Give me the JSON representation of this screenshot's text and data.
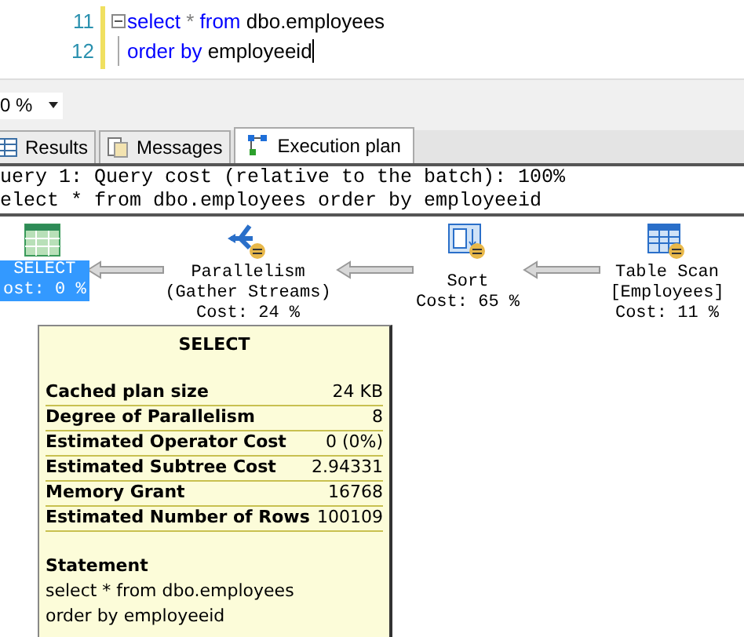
{
  "editor": {
    "lines": [
      {
        "number": "11",
        "fold": true,
        "segments": [
          {
            "text": "select",
            "kind": "keyword"
          },
          {
            "text": " * ",
            "kind": "operator"
          },
          {
            "text": "from",
            "kind": "keyword"
          },
          {
            "text": " dbo.employees",
            "kind": "plain"
          }
        ]
      },
      {
        "number": "12",
        "fold": false,
        "segments": [
          {
            "text": "order by",
            "kind": "keyword"
          },
          {
            "text": " employeeid",
            "kind": "plain"
          }
        ]
      }
    ]
  },
  "zoom": {
    "value": "0 %"
  },
  "tabs": [
    {
      "label": "Results",
      "kind": "grid",
      "selected": false
    },
    {
      "label": "Messages",
      "kind": "doc",
      "selected": false
    },
    {
      "label": "Execution plan",
      "kind": "plan",
      "selected": true
    }
  ],
  "query_header": [
    "uery 1: Query cost (relative to the batch): 100%",
    "elect * from dbo.employees order by employeeid"
  ],
  "plan_nodes": [
    {
      "kind": "select",
      "lines": [
        "SELECT"
      ],
      "cost": "ost: 0 %",
      "selected": true
    },
    {
      "kind": "parallelism",
      "lines": [
        "Parallelism",
        "(Gather Streams)"
      ],
      "cost": "Cost: 24 %",
      "selected": false
    },
    {
      "kind": "sort",
      "lines": [
        "Sort"
      ],
      "cost": "Cost: 65 %",
      "selected": false
    },
    {
      "kind": "scan",
      "lines": [
        "Table Scan",
        "[Employees]"
      ],
      "cost": "Cost: 11 %",
      "selected": false
    }
  ],
  "tooltip": {
    "title": "SELECT",
    "rows": [
      {
        "label": "Cached plan size",
        "value": "24 KB"
      },
      {
        "label": "Degree of Parallelism",
        "value": "8"
      },
      {
        "label": "Estimated Operator Cost",
        "value": "0 (0%)"
      },
      {
        "label": "Estimated Subtree Cost",
        "value": "2.94331"
      },
      {
        "label": "Memory Grant",
        "value": "16768"
      },
      {
        "label": "Estimated Number of Rows",
        "value": "100109"
      }
    ],
    "statement_heading": "Statement",
    "statement_lines": [
      "select * from dbo.employees",
      "order by employeeid"
    ]
  }
}
